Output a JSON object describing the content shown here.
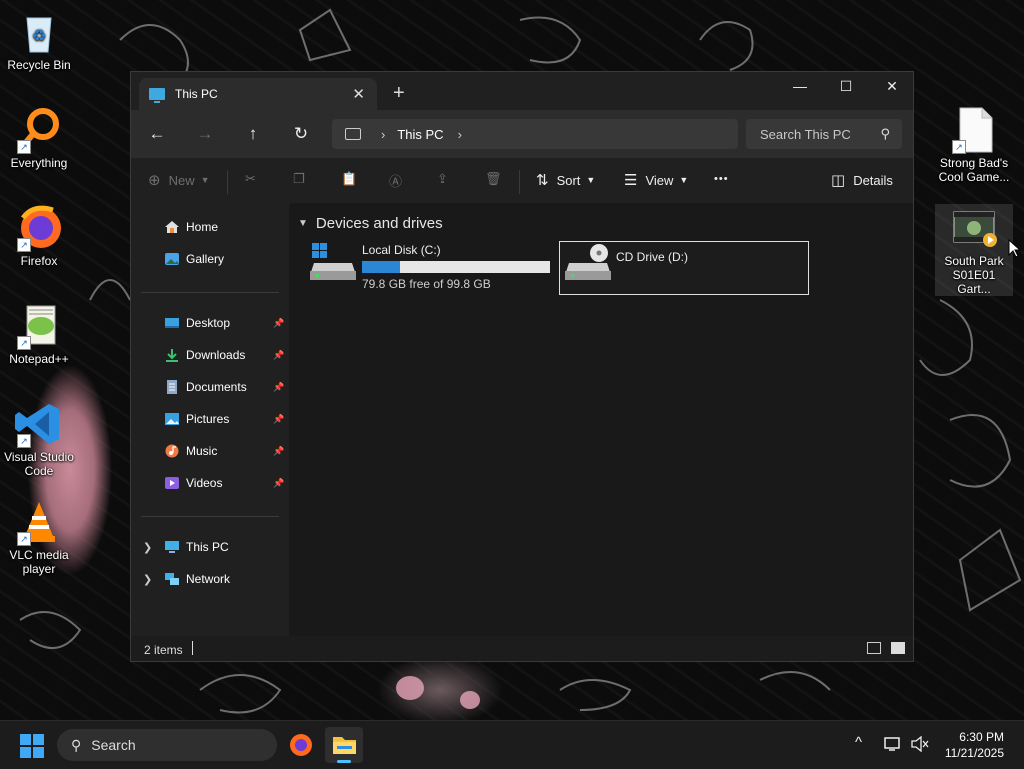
{
  "desktop": {
    "icons_left": [
      {
        "label": "Recycle Bin",
        "icon": "recycle-bin-icon"
      },
      {
        "label": "Everything",
        "icon": "everything-search-icon"
      },
      {
        "label": "Firefox",
        "icon": "firefox-icon"
      },
      {
        "label": "Notepad++",
        "icon": "notepad-plus-plus-icon"
      },
      {
        "label": "Visual Studio Code",
        "icon": "vscode-icon"
      },
      {
        "label": "VLC media player",
        "icon": "vlc-icon"
      }
    ],
    "icons_right": [
      {
        "label": "Strong Bad's Cool Game...",
        "icon": "blank-file-icon"
      },
      {
        "label": "South Park S01E01 Gart...",
        "icon": "video-file-icon"
      }
    ]
  },
  "explorer": {
    "tab": {
      "title": "This PC",
      "close": "✕"
    },
    "new_tab": "+",
    "window_controls": {
      "minimize": "—",
      "maximize": "☐",
      "close": "✕"
    },
    "nav": {
      "back": "←",
      "forward": "→",
      "up": "↑",
      "refresh": "↻"
    },
    "address": {
      "segments": [
        "This PC"
      ],
      "separator": "›"
    },
    "search": {
      "placeholder": "Search This PC"
    },
    "commandbar": {
      "new_label": "New",
      "sort_label": "Sort",
      "view_label": "View",
      "more_label": "•••",
      "details_label": "Details"
    },
    "navpane": {
      "top": [
        {
          "label": "Home",
          "icon": "home-icon"
        },
        {
          "label": "Gallery",
          "icon": "gallery-icon"
        }
      ],
      "quick_access": [
        {
          "label": "Desktop",
          "icon": "desktop-folder-icon"
        },
        {
          "label": "Downloads",
          "icon": "downloads-icon"
        },
        {
          "label": "Documents",
          "icon": "documents-icon"
        },
        {
          "label": "Pictures",
          "icon": "pictures-icon"
        },
        {
          "label": "Music",
          "icon": "music-icon"
        },
        {
          "label": "Videos",
          "icon": "videos-icon"
        }
      ],
      "tree": [
        {
          "label": "This PC",
          "icon": "this-pc-icon"
        },
        {
          "label": "Network",
          "icon": "network-icon"
        }
      ]
    },
    "content": {
      "section_title": "Devices and drives",
      "drives": [
        {
          "name": "Local Disk (C:)",
          "free_text": "79.8 GB free of 99.8 GB",
          "used_fraction": 0.2
        },
        {
          "name": "CD Drive (D:)",
          "selected": true
        }
      ]
    },
    "status": {
      "item_count": "2 items"
    }
  },
  "taskbar": {
    "search_label": "Search",
    "time": "6:30 PM",
    "date": "11/21/2025",
    "tray": {
      "overflow": "^"
    }
  },
  "colors": {
    "accent": "#2c86d6",
    "window_bg": "#191919",
    "taskbar_bg": "#1c1c1c"
  }
}
